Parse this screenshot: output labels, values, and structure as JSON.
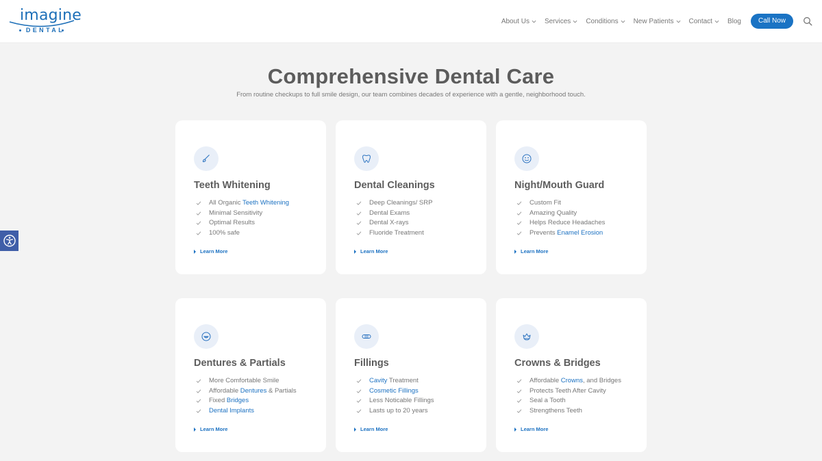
{
  "brand": {
    "name": "imagine",
    "sub": "DENTAL",
    "color": "#1d6fb8"
  },
  "nav": {
    "items": [
      {
        "label": "About Us",
        "dropdown": true
      },
      {
        "label": "Services",
        "dropdown": true
      },
      {
        "label": "Conditions",
        "dropdown": true
      },
      {
        "label": "New Patients",
        "dropdown": true
      },
      {
        "label": "Contact",
        "dropdown": true
      },
      {
        "label": "Blog",
        "dropdown": false
      }
    ],
    "cta": "Call Now",
    "search_icon": "search-icon"
  },
  "accessibility_icon": "accessibility-icon",
  "hero": {
    "title": "Comprehensive Dental Care",
    "subtitle": "From routine checkups to full smile design, our team combines decades of experience with a gentle, neighborhood touch."
  },
  "cards": [
    {
      "icon": "brush-icon",
      "title": "Teeth Whitening",
      "items": [
        [
          {
            "t": "All Organic "
          },
          {
            "t": "Teeth Whitening",
            "link": true
          }
        ],
        [
          {
            "t": "Minimal Sensitivity"
          }
        ],
        [
          {
            "t": "Optimal Results"
          }
        ],
        [
          {
            "t": "100% safe"
          }
        ]
      ],
      "cta": "Learn More"
    },
    {
      "icon": "tooth-icon",
      "title": "Dental Cleanings",
      "items": [
        [
          {
            "t": "Deep Cleanings/ SRP"
          }
        ],
        [
          {
            "t": "Dental Exams"
          }
        ],
        [
          {
            "t": "Dental X-rays"
          }
        ],
        [
          {
            "t": "Fluoride Treatment"
          }
        ]
      ],
      "cta": "Learn More"
    },
    {
      "icon": "mouth-guard-icon",
      "title": "Night/Mouth Guard",
      "items": [
        [
          {
            "t": "Custom Fit"
          }
        ],
        [
          {
            "t": "Amazing Quality"
          }
        ],
        [
          {
            "t": "Helps Reduce Headaches"
          }
        ],
        [
          {
            "t": "Prevents "
          },
          {
            "t": "Enamel Erosion",
            "link": true
          }
        ]
      ],
      "cta": "Learn More"
    },
    {
      "icon": "smile-icon",
      "title": "Dentures & Partials",
      "items": [
        [
          {
            "t": "More Comfortable Smile"
          }
        ],
        [
          {
            "t": "Affordable "
          },
          {
            "t": "Dentures",
            "link": true
          },
          {
            "t": " & Partials"
          }
        ],
        [
          {
            "t": "Fixed "
          },
          {
            "t": "Bridges",
            "link": true
          }
        ],
        [
          {
            "t": "Dental Implants",
            "link": true
          }
        ]
      ],
      "cta": "Learn More"
    },
    {
      "icon": "filling-icon",
      "title": "Fillings",
      "items": [
        [
          {
            "t": "Cavity",
            "link": true
          },
          {
            "t": " Treatment"
          }
        ],
        [
          {
            "t": "Cosmetic Fillings",
            "link": true
          }
        ],
        [
          {
            "t": "Less Noticable Fillings"
          }
        ],
        [
          {
            "t": "Lasts up to 20 years"
          }
        ]
      ],
      "cta": "Learn More"
    },
    {
      "icon": "crown-icon",
      "title": "Crowns & Bridges",
      "items": [
        [
          {
            "t": "Affordable "
          },
          {
            "t": "Crowns",
            "link": true
          },
          {
            "t": ", and Bridges"
          }
        ],
        [
          {
            "t": "Protects Teeth After Cavity"
          }
        ],
        [
          {
            "t": "Seal a Tooth"
          }
        ],
        [
          {
            "t": "Strengthens Teeth"
          }
        ]
      ],
      "cta": "Learn More"
    }
  ],
  "colors": {
    "accent": "#1a73c4",
    "link": "#1d72c2",
    "background": "#f3f3f3",
    "card": "#ffffff",
    "a11y": "#3f5ea8"
  }
}
